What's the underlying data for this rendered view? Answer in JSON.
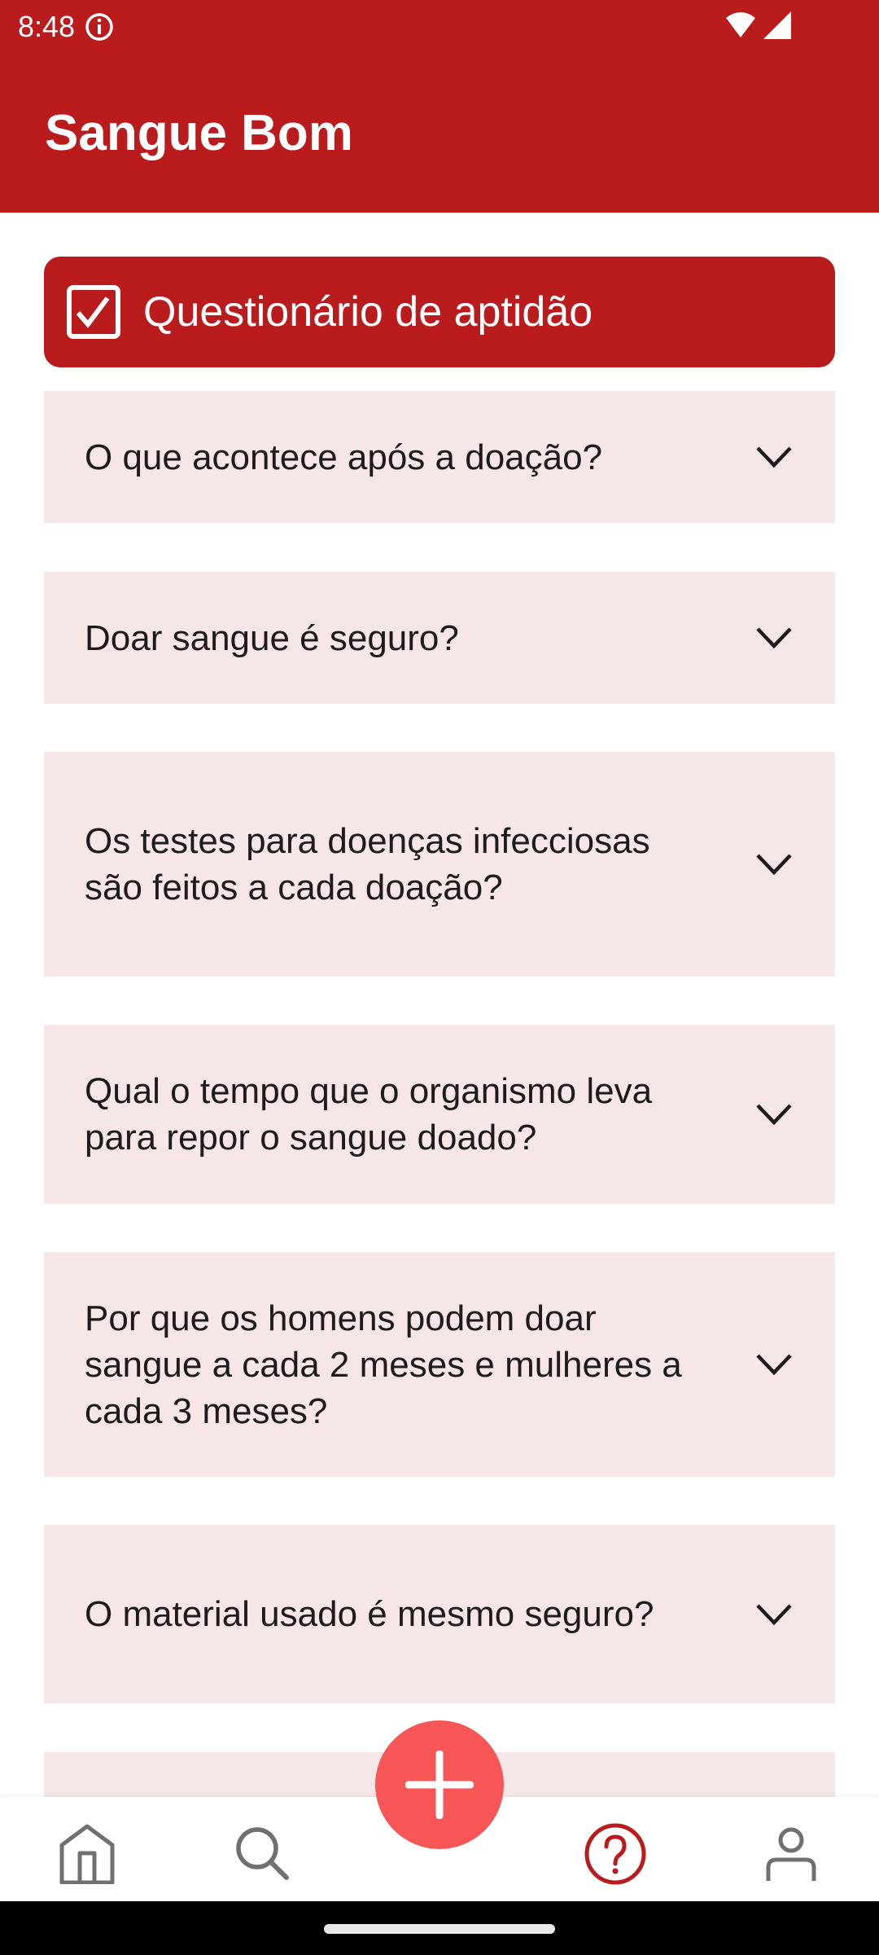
{
  "status_bar": {
    "time": "8:48"
  },
  "app_bar": {
    "title": "Sangue Bom"
  },
  "questionnaire_button": {
    "label": "Questionário de aptidão"
  },
  "faq": [
    "O que acontece após a doação?",
    "Doar sangue é seguro?",
    "Os testes para doenças infecciosas são feitos a cada doação?",
    "Qual o tempo que o organismo leva para repor o sangue doado?",
    "Por que os homens podem doar sangue a cada 2 meses e mulheres a cada 3 meses?",
    "O material usado é mesmo seguro?",
    ""
  ],
  "bottom_nav": {
    "items": [
      "home-icon",
      "search-icon",
      "add-icon",
      "help-icon",
      "profile-icon"
    ],
    "active": "help-icon"
  },
  "colors": {
    "primary": "#ba1b1d",
    "card": "#f7e6e7",
    "fab": "#f65656",
    "inactive": "#707070"
  }
}
